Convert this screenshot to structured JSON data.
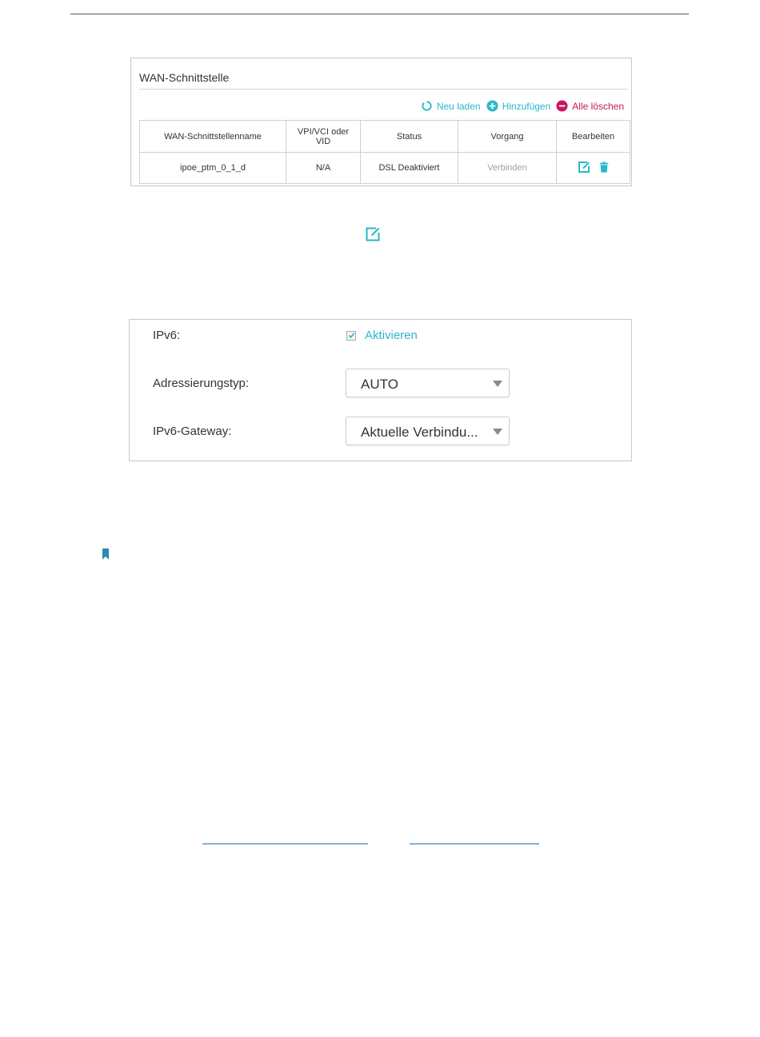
{
  "wan": {
    "title": "WAN-Schnittstelle",
    "actions": {
      "refresh": "Neu laden",
      "add": "Hinzufügen",
      "delete_all": "Alle löschen"
    },
    "columns": [
      "WAN-Schnittstellenname",
      "VPI/VCI oder VID",
      "Status",
      "Vorgang",
      "Bearbeiten"
    ],
    "rows": [
      {
        "name": "ipoe_ptm_0_1_d",
        "vpi": "N/A",
        "status": "DSL Deaktiviert",
        "action": "Verbinden"
      }
    ]
  },
  "ipv6": {
    "label": "IPv6:",
    "enable_label": "Aktivieren",
    "enabled": true,
    "addressing_label": "Adressierungstyp:",
    "addressing_value": "AUTO",
    "gateway_label": "IPv6-Gateway:",
    "gateway_value": "Aktuelle Verbindu..."
  },
  "colors": {
    "accent": "#2ab7c9",
    "danger": "#c8175d",
    "note": "#2d8ab0"
  }
}
